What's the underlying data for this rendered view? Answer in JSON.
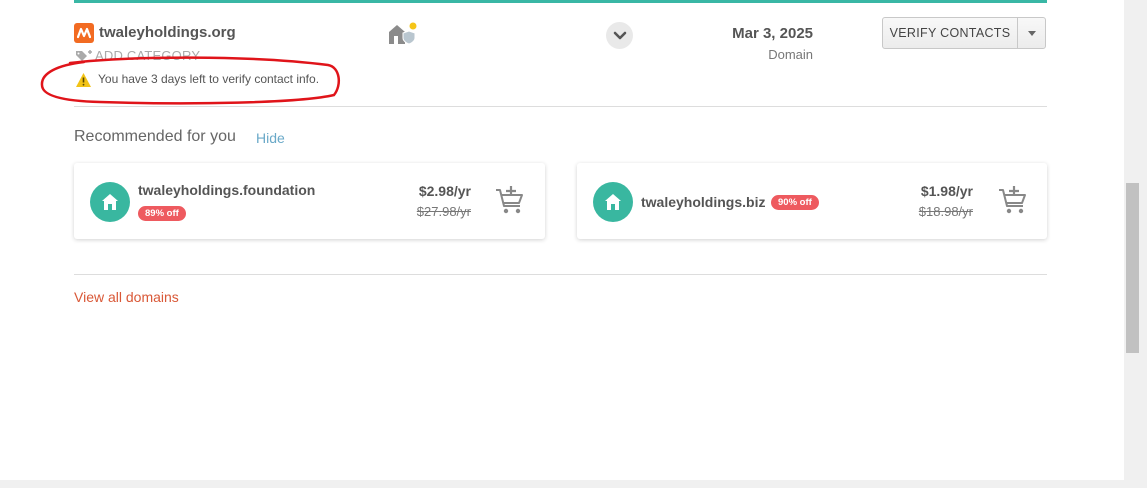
{
  "domain_row": {
    "name": "twaleyholdings.org",
    "add_category": "ADD CATEGORY",
    "warning": "You have 3 days left to verify contact info.",
    "expiry_date": "Mar 3, 2025",
    "expiry_type": "Domain",
    "action_label": "VERIFY CONTACTS",
    "logo_color": "#f26b22",
    "status_icon": "house-with-shield-icon",
    "expand_icon": "chevron-down-icon",
    "annotation_color": "#e0141a"
  },
  "recommended": {
    "title": "Recommended for you",
    "hide_label": "Hide",
    "items": [
      {
        "domain": "twaleyholdings.foundation",
        "discount": "89% off",
        "price": "$2.98/yr",
        "old_price": "$27.98/yr",
        "icon": "house-icon"
      },
      {
        "domain": "twaleyholdings.biz",
        "discount": "90% off",
        "price": "$1.98/yr",
        "old_price": "$18.98/yr",
        "icon": "house-icon"
      }
    ]
  },
  "view_all_label": "View all domains",
  "colors": {
    "accent_teal": "#39b7a5",
    "badge_red": "#ee5a5f",
    "link_orange": "#d95837",
    "link_blue": "#6aa9c8"
  }
}
